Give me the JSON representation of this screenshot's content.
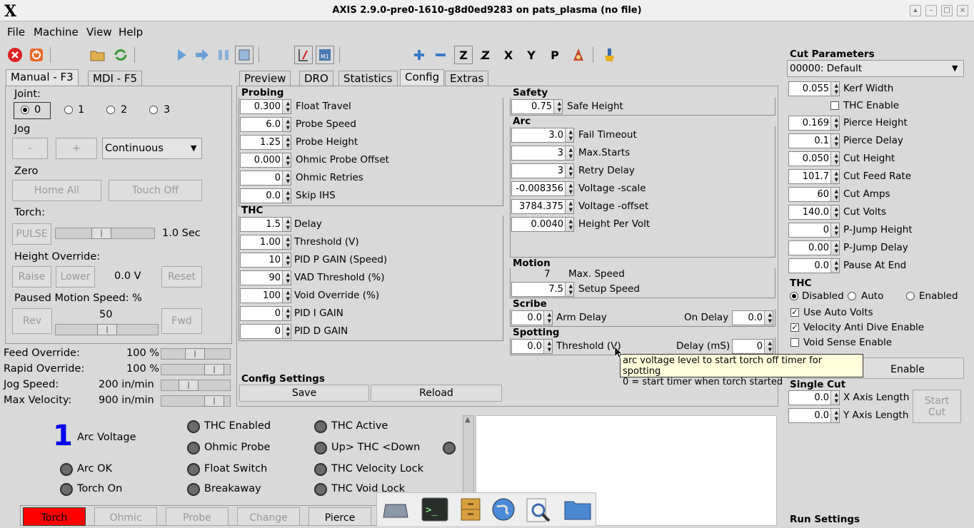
{
  "window": {
    "title": "AXIS 2.9.0-pre0-1610-g8d0ed9283 on pats_plasma (no file)",
    "logo": "X"
  },
  "menu": [
    "File",
    "Machine",
    "View",
    "Help"
  ],
  "left_tabs": [
    "Manual - F3",
    "MDI - F5"
  ],
  "manual": {
    "joint_label": "Joint:",
    "joints": [
      "0",
      "1",
      "2",
      "3"
    ],
    "jog_label": "Jog",
    "jog_minus": "-",
    "jog_plus": "+",
    "jog_mode": "Continuous",
    "zero_label": "Zero",
    "home_all": "Home All",
    "touch_off": "Touch Off",
    "torch_label": "Torch:",
    "pulse": "PULSE",
    "pulse_value": "1.0 Sec",
    "pulse_level": 0.45,
    "height_override_label": "Height Override:",
    "raise": "Raise",
    "lower": "Lower",
    "height_value": "0.0 V",
    "reset": "Reset",
    "paused_label": "Paused Motion Speed: %",
    "rev": "Rev",
    "fwd": "Fwd",
    "paused_value": "50",
    "paused_level": 0.5
  },
  "overrides": [
    {
      "label": "Feed Override:",
      "value": "100 %",
      "level": 0.48
    },
    {
      "label": "Rapid Override:",
      "value": "100 %",
      "level": 0.88
    },
    {
      "label": "Jog Speed:",
      "value": "200 in/min",
      "level": 0.35
    },
    {
      "label": "Max Velocity:",
      "value": "900 in/min",
      "level": 0.88
    }
  ],
  "right_tabs": [
    "Preview",
    "DRO",
    "Statistics",
    "Config",
    "Extras"
  ],
  "probing": {
    "title": "Probing",
    "fields": [
      {
        "value": "0.300",
        "label": "Float Travel"
      },
      {
        "value": "6.0",
        "label": "Probe Speed"
      },
      {
        "value": "1.25",
        "label": "Probe Height"
      },
      {
        "value": "0.000",
        "label": "Ohmic Probe Offset"
      },
      {
        "value": "0",
        "label": "Ohmic Retries"
      },
      {
        "value": "0.0",
        "label": "Skip IHS"
      }
    ]
  },
  "thc": {
    "title": "THC",
    "fields": [
      {
        "value": "1.5",
        "label": "Delay"
      },
      {
        "value": "1.00",
        "label": "Threshold (V)"
      },
      {
        "value": "10",
        "label": "PID P GAIN (Speed)"
      },
      {
        "value": "90",
        "label": "VAD Threshold (%)"
      },
      {
        "value": "100",
        "label": "Void Override (%)"
      },
      {
        "value": "0",
        "label": "PID I GAIN"
      },
      {
        "value": "0",
        "label": "PID D GAIN"
      }
    ]
  },
  "safety": {
    "title": "Safety",
    "value": "0.75",
    "label": "Safe Height"
  },
  "arc": {
    "title": "Arc",
    "fields": [
      {
        "value": "3.0",
        "label": "Fail Timeout"
      },
      {
        "value": "3",
        "label": "Max.Starts"
      },
      {
        "value": "3",
        "label": "Retry Delay"
      },
      {
        "value": "-0.008356",
        "label": "Voltage -scale"
      },
      {
        "value": "3784.375",
        "label": "Voltage -offset"
      },
      {
        "value": "0.0040",
        "label": "Height Per Volt"
      }
    ]
  },
  "motion": {
    "title": "Motion",
    "max_value": "7",
    "max_label": "Max. Speed",
    "setup_value": "7.5",
    "setup_label": "Setup Speed"
  },
  "scribe": {
    "title": "Scribe",
    "arm_value": "0.0",
    "arm_label": "Arm Delay",
    "on_label": "On Delay",
    "on_value": "0.0"
  },
  "spotting": {
    "title": "Spotting",
    "th_value": "0.0",
    "th_label": "Threshold (V)",
    "delay_label": "Delay (mS)",
    "delay_value": "0"
  },
  "tooltip": {
    "line1": "arc voltage level to start torch off timer for spotting",
    "line2": "0 = start timer when torch started"
  },
  "config_settings": {
    "title": "Config Settings",
    "save": "Save",
    "reload": "Reload"
  },
  "cut_params": {
    "title": "Cut Parameters",
    "material": "00000: Default",
    "kerf_value": "0.055",
    "kerf_label": "Kerf Width",
    "thc_enable": "THC Enable",
    "fields": [
      {
        "value": "0.169",
        "label": "Pierce Height"
      },
      {
        "value": "0.1",
        "label": "Pierce Delay"
      },
      {
        "value": "0.050",
        "label": "Cut Height"
      },
      {
        "value": "101.7",
        "label": "Cut Feed Rate"
      },
      {
        "value": "60",
        "label": "Cut Amps"
      },
      {
        "value": "140.0",
        "label": "Cut Volts"
      },
      {
        "value": "0",
        "label": "P-Jump Height"
      },
      {
        "value": "0.00",
        "label": "P-Jump Delay"
      },
      {
        "value": "0.0",
        "label": "Pause At End"
      }
    ]
  },
  "thc_right": {
    "title": "THC",
    "disabled": "Disabled",
    "auto": "Auto",
    "enabled": "Enabled",
    "use_auto_volts": "Use Auto Volts",
    "vad": "Velocity Anti Dive Enable",
    "void": "Void Sense Enable",
    "enable_btn": "Enable"
  },
  "single_cut": {
    "title": "Single Cut",
    "x_value": "0.0",
    "x_label": "X Axis Length",
    "y_value": "0.0",
    "y_label": "Y Axis Length",
    "start": "Start",
    "cut": "Cut"
  },
  "run_settings": "Run Settings",
  "status": {
    "arc_number": "1",
    "arc_voltage": "Arc Voltage",
    "arc_ok": "Arc OK",
    "torch_on": "Torch On",
    "thc_enabled": "THC Enabled",
    "ohmic_probe": "Ohmic Probe",
    "float_switch": "Float Switch",
    "breakaway": "Breakaway",
    "thc_active": "THC Active",
    "up_down": "Up> THC <Down",
    "thc_vel_lock": "THC Velocity Lock",
    "thc_void_lock": "THC Void Lock"
  },
  "bottom_buttons": [
    "Torch",
    "Ohmic",
    "Probe",
    "Change",
    "Pierce"
  ],
  "colors": {
    "accent_blue": "#0000ee",
    "torch_red": "#ff0000",
    "tooltip_bg": "#ffffdc"
  }
}
